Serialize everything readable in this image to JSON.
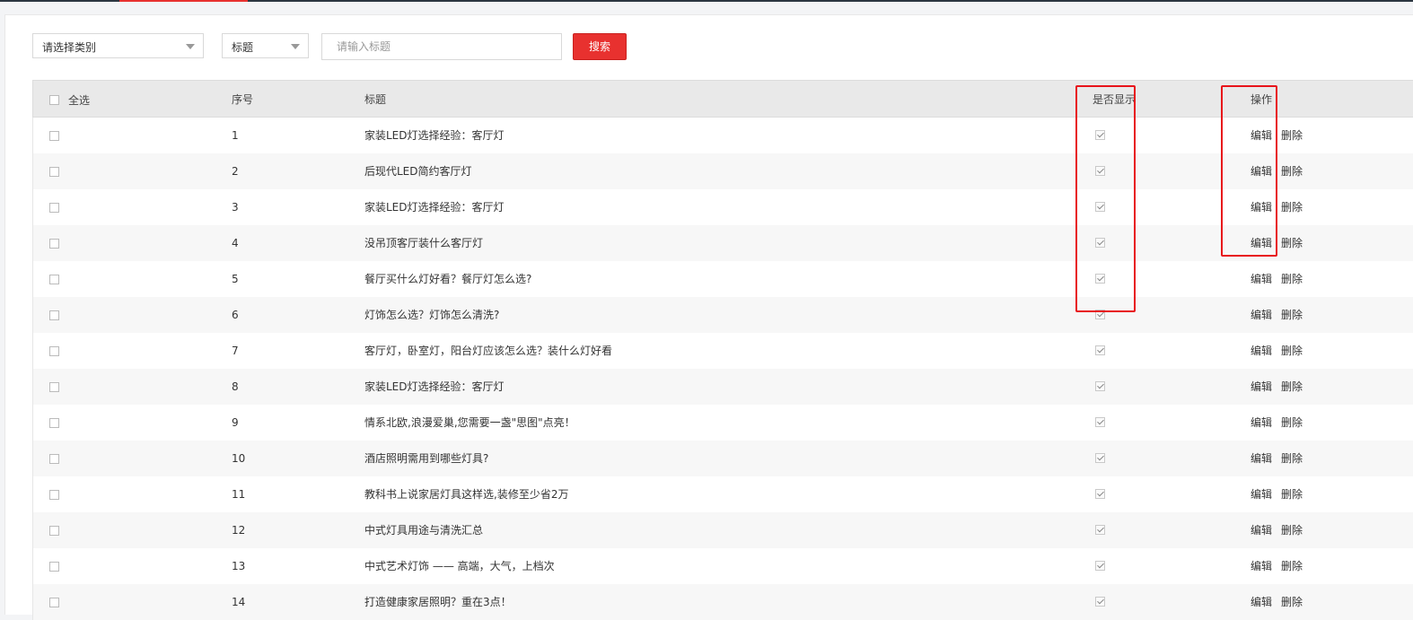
{
  "filters": {
    "category_select": "请选择类别",
    "field_select": "标题",
    "search_placeholder": "请输入标题",
    "search_button": "搜索"
  },
  "table": {
    "headers": {
      "select_all": "全选",
      "number": "序号",
      "title": "标题",
      "visible": "是否显示",
      "actions": "操作"
    },
    "rows": [
      {
        "num": "1",
        "title": "家装LED灯选择经验：客厅灯",
        "visible": true
      },
      {
        "num": "2",
        "title": "后现代LED简约客厅灯",
        "visible": true
      },
      {
        "num": "3",
        "title": "家装LED灯选择经验：客厅灯",
        "visible": true
      },
      {
        "num": "4",
        "title": "没吊顶客厅装什么客厅灯",
        "visible": true
      },
      {
        "num": "5",
        "title": "餐厅买什么灯好看？餐厅灯怎么选?",
        "visible": true
      },
      {
        "num": "6",
        "title": "灯饰怎么选？灯饰怎么清洗?",
        "visible": true
      },
      {
        "num": "7",
        "title": "客厅灯，卧室灯，阳台灯应该怎么选？装什么灯好看",
        "visible": true
      },
      {
        "num": "8",
        "title": "家装LED灯选择经验：客厅灯",
        "visible": true
      },
      {
        "num": "9",
        "title": "情系北欧,浪漫爱巢,您需要一盏\"思图\"点亮！",
        "visible": true
      },
      {
        "num": "10",
        "title": "酒店照明需用到哪些灯具?",
        "visible": true
      },
      {
        "num": "11",
        "title": "教科书上说家居灯具这样选,装修至少省2万",
        "visible": true
      },
      {
        "num": "12",
        "title": "中式灯具用途与清洗汇总",
        "visible": true
      },
      {
        "num": "13",
        "title": "中式艺术灯饰 —— 高端，大气，上档次",
        "visible": true
      },
      {
        "num": "14",
        "title": "打造健康家居照明？重在3点！",
        "visible": true
      }
    ],
    "action_edit": "编辑",
    "action_delete": "删除"
  },
  "colors": {
    "accent": "#e8312f",
    "highlight_box": "#e8141b",
    "header_bg": "#e9e9e9",
    "stripe_bg": "#f7f7f7"
  }
}
